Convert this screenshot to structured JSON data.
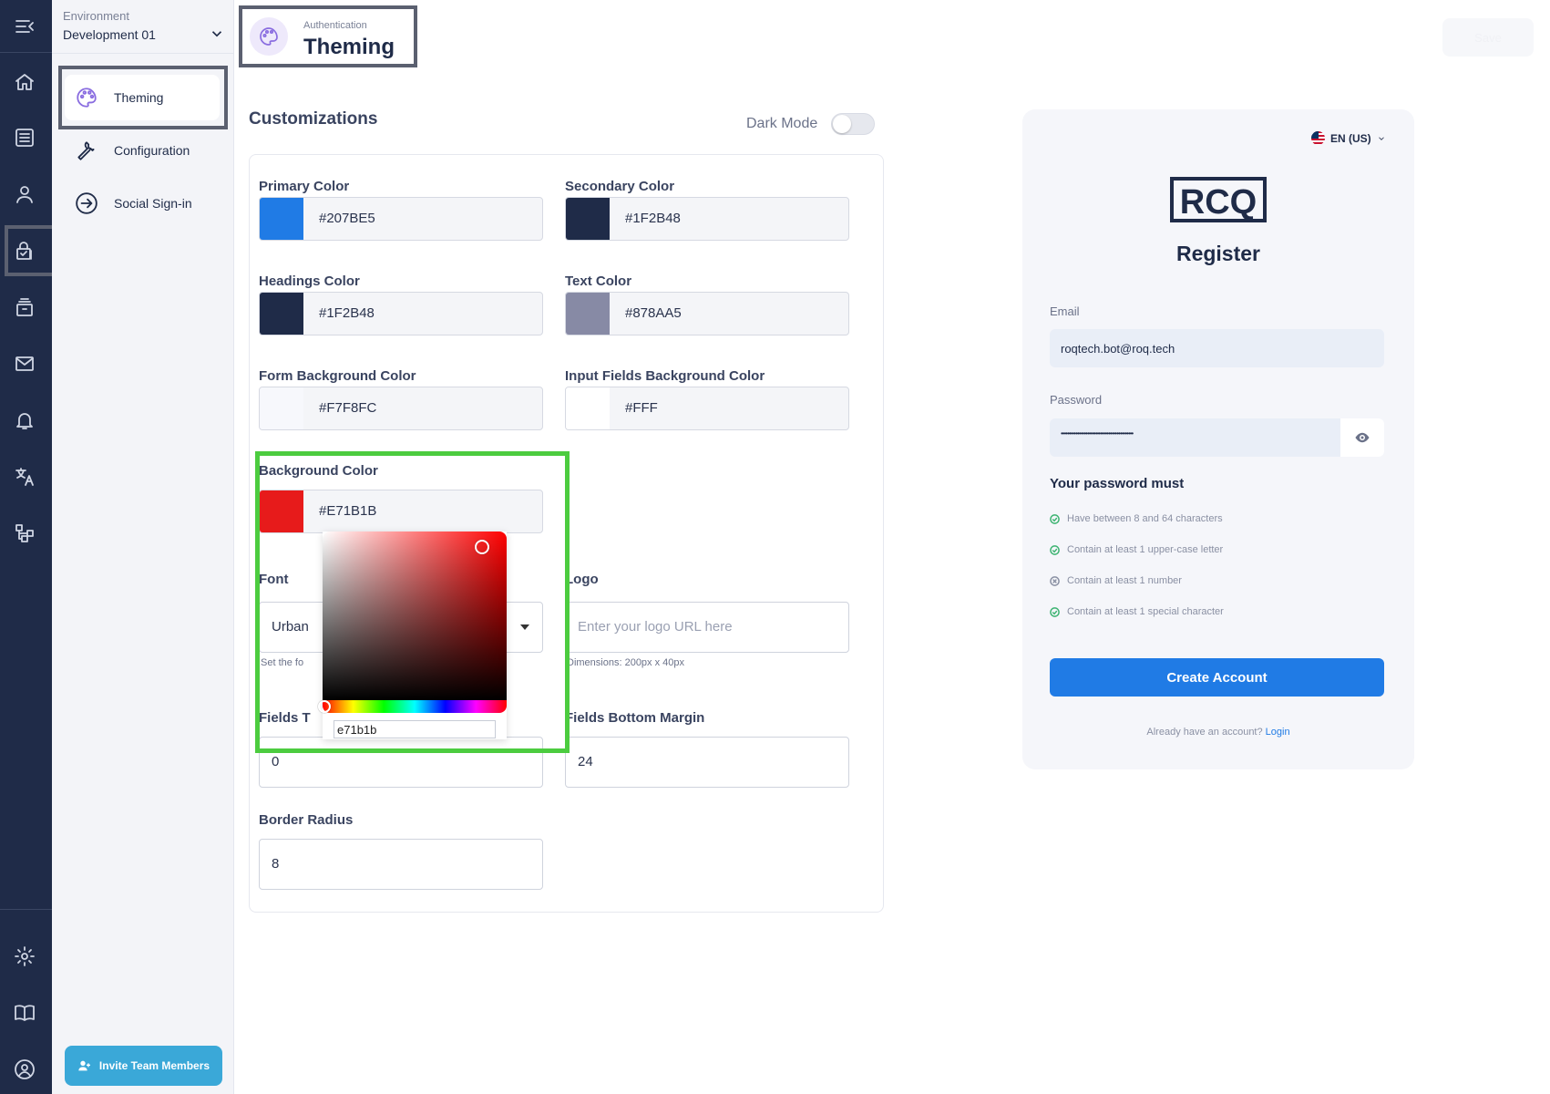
{
  "environment": {
    "label": "Environment",
    "value": "Development 01"
  },
  "subnav": {
    "items": [
      {
        "label": "Theming",
        "active": true
      },
      {
        "label": "Configuration"
      },
      {
        "label": "Social Sign-in"
      }
    ],
    "invite_label": "Invite Team Members"
  },
  "header": {
    "breadcrumb": "Authentication",
    "title": "Theming",
    "ghost_button": "Save"
  },
  "customizations": {
    "title": "Customizations",
    "dark_mode_label": "Dark Mode",
    "dark_mode_on": false,
    "primary": {
      "label": "Primary Color",
      "value": "#207BE5",
      "swatch": "#207be5"
    },
    "secondary": {
      "label": "Secondary Color",
      "value": "#1F2B48",
      "swatch": "#1f2b48"
    },
    "headings": {
      "label": "Headings Color",
      "value": "#1F2B48",
      "swatch": "#1f2b48"
    },
    "text": {
      "label": "Text Color",
      "value": "#878AA5",
      "swatch": "#878aa5"
    },
    "form_bg": {
      "label": "Form Background Color",
      "value": "#F7F8FC",
      "swatch": "#f7f8fc"
    },
    "input_bg": {
      "label": "Input Fields Background Color",
      "value": "#FFF",
      "swatch": "#ffffff"
    },
    "background": {
      "label": "Background Color",
      "value": "#E71B1B",
      "swatch": "#e71b1b"
    },
    "font": {
      "label": "Font",
      "value": "Urbanist",
      "visible_value": "Urban",
      "help": "Set the fo"
    },
    "logo": {
      "label": "Logo",
      "placeholder": "Enter your logo URL here",
      "help": "Dimensions: 200px x 40px"
    },
    "fields_top": {
      "label": "Fields Top Margin",
      "visible_label": "Fields T",
      "value": "0"
    },
    "fields_bottom": {
      "label": "Fields Bottom Margin",
      "value": "24"
    },
    "border_radius": {
      "label": "Border Radius",
      "value": "8"
    }
  },
  "color_picker": {
    "hex_input": "e71b1b",
    "hue": "#ff0000"
  },
  "preview": {
    "language": "EN (US)",
    "logo_text": "RCQ",
    "title": "Register",
    "email_label": "Email",
    "email_value": "roqtech.bot@roq.tech",
    "password_label": "Password",
    "password_value": "••••••••••••••••••••••••••••••••••••••••••••",
    "rules_title": "Your password must",
    "rules": [
      {
        "text": "Have between 8 and 64 characters",
        "ok": true
      },
      {
        "text": "Contain at least 1 upper-case letter",
        "ok": true
      },
      {
        "text": "Contain at least 1 number",
        "ok": false
      },
      {
        "text": "Contain at least 1 special character",
        "ok": true
      }
    ],
    "create_label": "Create Account",
    "login_prompt": "Already have an account?",
    "login_link": "Login"
  },
  "colors": {
    "rail": "#1f2b48",
    "accent": "#207be5",
    "highlight_green": "#4ccc3f",
    "ok_green": "#3cb371"
  }
}
